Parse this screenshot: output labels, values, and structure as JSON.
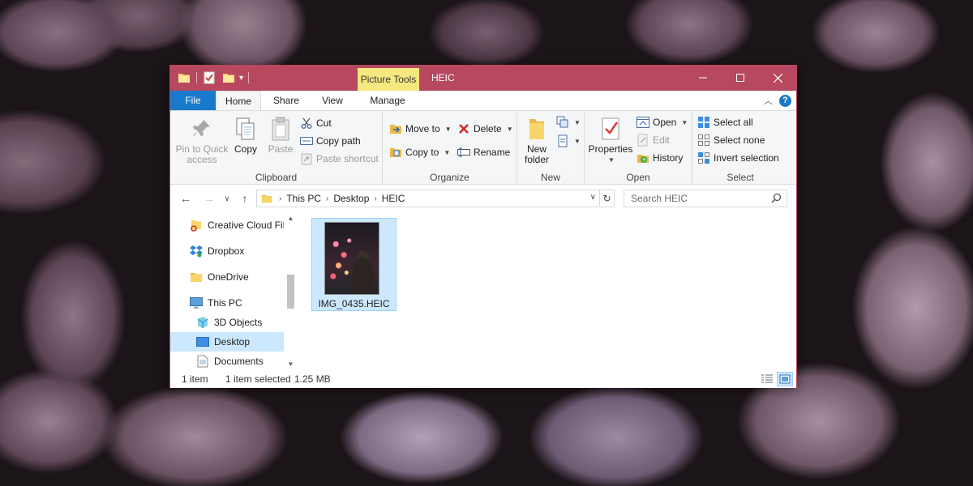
{
  "window": {
    "title": "HEIC",
    "contextual_tab": "Picture Tools",
    "accent": "#b7485f",
    "contextual_color": "#f5e87e"
  },
  "tabs": {
    "file": "File",
    "home": "Home",
    "share": "Share",
    "view": "View",
    "manage": "Manage"
  },
  "ribbon": {
    "clipboard": {
      "label": "Clipboard",
      "pin": "Pin to Quick access",
      "copy": "Copy",
      "paste": "Paste",
      "cut": "Cut",
      "copy_path": "Copy path",
      "paste_shortcut": "Paste shortcut"
    },
    "organize": {
      "label": "Organize",
      "move_to": "Move to",
      "copy_to": "Copy to",
      "delete": "Delete",
      "rename": "Rename"
    },
    "new": {
      "label": "New",
      "new_folder_line1": "New",
      "new_folder_line2": "folder"
    },
    "open": {
      "label": "Open",
      "properties": "Properties",
      "open": "Open",
      "edit": "Edit",
      "history": "History"
    },
    "select": {
      "label": "Select",
      "select_all": "Select all",
      "select_none": "Select none",
      "invert": "Invert selection"
    }
  },
  "address": {
    "crumbs": [
      "This PC",
      "Desktop",
      "HEIC"
    ],
    "search_placeholder": "Search HEIC"
  },
  "nav_pane": {
    "items": [
      {
        "label": "Creative Cloud Fil",
        "icon": "creative-cloud-icon"
      },
      {
        "label": "Dropbox",
        "icon": "dropbox-icon"
      },
      {
        "label": "OneDrive",
        "icon": "folder-icon"
      },
      {
        "label": "This PC",
        "icon": "monitor-icon"
      },
      {
        "label": "3D Objects",
        "icon": "cube-icon"
      },
      {
        "label": "Desktop",
        "icon": "desktop-icon",
        "selected": true
      },
      {
        "label": "Documents",
        "icon": "document-icon"
      }
    ]
  },
  "files": [
    {
      "name": "IMG_0435.HEIC",
      "selected": true
    }
  ],
  "status": {
    "count": "1 item",
    "selected": "1 item selected",
    "size": "1.25 MB"
  }
}
